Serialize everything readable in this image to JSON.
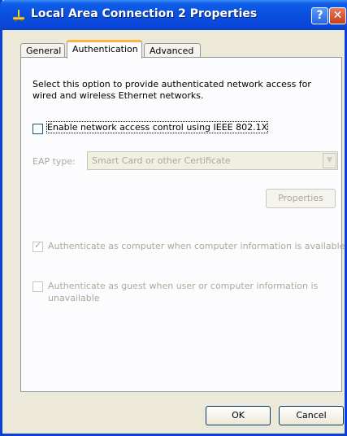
{
  "window": {
    "title": "Local Area Connection 2 Properties",
    "help_label": "?",
    "close_label": "✕"
  },
  "tabs": [
    {
      "label": "General",
      "active": false
    },
    {
      "label": "Authentication",
      "active": true
    },
    {
      "label": "Advanced",
      "active": false
    }
  ],
  "auth": {
    "description": "Select this option to provide authenticated network access for wired and wireless Ethernet networks.",
    "enable_8021x": {
      "label": "Enable network access control using IEEE 802.1X",
      "checked": false
    },
    "eap_type": {
      "label": "EAP type:",
      "selected": "Smart Card or other Certificate",
      "enabled": false
    },
    "properties_button": "Properties",
    "auth_as_computer": {
      "label": "Authenticate as computer when computer information is available",
      "checked": true,
      "enabled": false
    },
    "auth_as_guest": {
      "label_line1": "Authenticate as guest when user or computer information is",
      "label_line2": "unavailable",
      "checked": false,
      "enabled": false
    }
  },
  "footer": {
    "ok_label": "OK",
    "cancel_label": "Cancel"
  },
  "colors": {
    "titlebar": "#0a4ee0",
    "face": "#ece9d8",
    "disabled_text": "#aca899",
    "active_tab_accent": "#f8b43c"
  }
}
